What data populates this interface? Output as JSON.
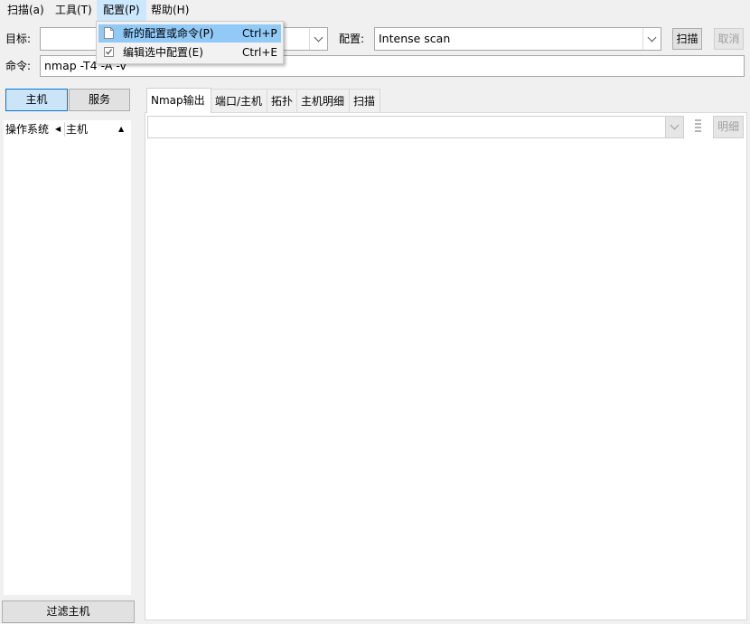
{
  "menubar": {
    "items": [
      {
        "label": "扫描(a)"
      },
      {
        "label": "工具(T)"
      },
      {
        "label": "配置(P)"
      },
      {
        "label": "帮助(H)"
      }
    ]
  },
  "config_menu": {
    "items": [
      {
        "label": "新的配置或命令(P)",
        "shortcut": "Ctrl+P",
        "icon": "new-document-icon"
      },
      {
        "label": "编辑选中配置(E)",
        "shortcut": "Ctrl+E",
        "icon": "edit-checkbox-icon"
      }
    ]
  },
  "target": {
    "label": "目标:",
    "value": ""
  },
  "profile": {
    "label": "配置:",
    "value": "Intense scan"
  },
  "buttons": {
    "scan": "扫描",
    "cancel": "取消",
    "details": "明细",
    "filter_hosts": "过滤主机"
  },
  "command": {
    "label": "命令:",
    "value": "nmap -T4 -A -v"
  },
  "left_toggle": {
    "hosts": "主机",
    "services": "服务"
  },
  "host_columns": {
    "os": "操作系统",
    "host": "主机"
  },
  "tabs": [
    {
      "label": "Nmap输出",
      "active": true
    },
    {
      "label": "端口/主机"
    },
    {
      "label": "拓扑"
    },
    {
      "label": "主机明细"
    },
    {
      "label": "扫描"
    }
  ],
  "output": {
    "selected": ""
  }
}
